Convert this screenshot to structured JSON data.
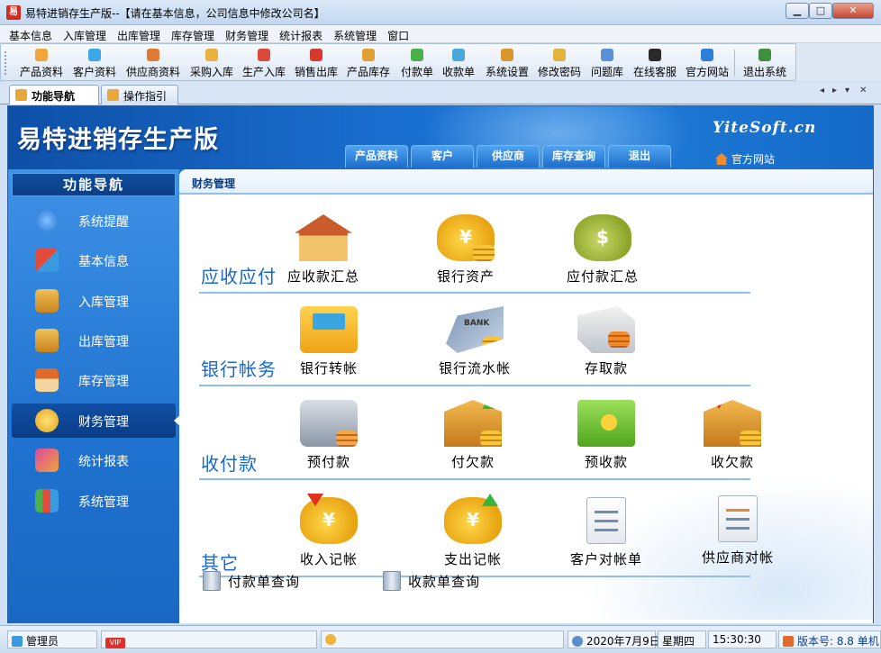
{
  "window": {
    "title": "易特进销存生产版--【请在基本信息，公司信息中修改公司名】",
    "app_icon_text": "易",
    "controls": {
      "minimize": "▁",
      "maximize": "□",
      "close": "✕"
    }
  },
  "menu": [
    "基本信息",
    "入库管理",
    "出库管理",
    "库存管理",
    "财务管理",
    "统计报表",
    "系统管理",
    "窗口"
  ],
  "toolbar": [
    {
      "label": "产品资料",
      "icon": "product-icon",
      "color": "#f0a63a"
    },
    {
      "label": "客户资料",
      "icon": "customer-icon",
      "color": "#3aa7e6"
    },
    {
      "label": "供应商资料",
      "icon": "supplier-icon",
      "color": "#e07a32"
    },
    {
      "label": "采购入库",
      "icon": "purchase-icon",
      "color": "#e9b23f"
    },
    {
      "label": "生产入库",
      "icon": "production-icon",
      "color": "#d94a3b"
    },
    {
      "label": "销售出库",
      "icon": "sales-icon",
      "color": "#d63a2f"
    },
    {
      "label": "产品库存",
      "icon": "inventory-icon",
      "color": "#e0a235"
    },
    {
      "label": "付款单",
      "icon": "payment-icon",
      "color": "#4bb04b"
    },
    {
      "label": "收款单",
      "icon": "receipt-icon",
      "color": "#49a8d8"
    },
    {
      "label": "系统设置",
      "icon": "settings-icon",
      "color": "#d8962e"
    },
    {
      "label": "修改密码",
      "icon": "password-icon",
      "color": "#e1b43d"
    },
    {
      "label": "问题库",
      "icon": "question-icon",
      "color": "#5b8fd6"
    },
    {
      "label": "在线客服",
      "icon": "qq-icon",
      "color": "#2a2a2a"
    },
    {
      "label": "官方网站",
      "icon": "ie-icon",
      "color": "#2e7fd8"
    },
    {
      "label": "退出系统",
      "icon": "exit-icon",
      "color": "#3f8f3f"
    }
  ],
  "tabs": [
    {
      "label": "功能导航",
      "active": true
    },
    {
      "label": "操作指引",
      "active": false
    }
  ],
  "tab_controls": [
    "◂",
    "▸",
    "▾",
    "✕"
  ],
  "banner": {
    "title": "易特进销存生产版",
    "site": "YiteSoft.cn",
    "tabs": [
      "产品资料",
      "客户",
      "供应商",
      "库存查询",
      "退出"
    ],
    "home_link": "官方网站"
  },
  "sidebar": {
    "header": "功能导航",
    "items": [
      {
        "label": "系统提醒",
        "icon": "info-icon",
        "color": "#3a8fe0"
      },
      {
        "label": "基本信息",
        "icon": "cubes-icon",
        "color": "#e24a3a"
      },
      {
        "label": "入库管理",
        "icon": "box-in-icon",
        "color": "#e0a235"
      },
      {
        "label": "出库管理",
        "icon": "box-out-icon",
        "color": "#e0a235"
      },
      {
        "label": "库存管理",
        "icon": "warehouse-icon",
        "color": "#e06a2a"
      },
      {
        "label": "财务管理",
        "icon": "finance-icon",
        "color": "#f2c33a",
        "active": true
      },
      {
        "label": "统计报表",
        "icon": "report-icon",
        "color": "#d94aa0"
      },
      {
        "label": "系统管理",
        "icon": "system-icon",
        "color": "#4bb04b"
      }
    ]
  },
  "content": {
    "breadcrumb": "财务管理",
    "sections": [
      {
        "title": "应收应付",
        "items": [
          "应收款汇总",
          "银行资产",
          "应付款汇总"
        ]
      },
      {
        "title": "银行帐务",
        "items": [
          "银行转帐",
          "银行流水帐",
          "存取款"
        ]
      },
      {
        "title": "收付款",
        "items": [
          "预付款",
          "付欠款",
          "预收款",
          "收欠款"
        ]
      },
      {
        "title": "其它",
        "items": [
          "收入记帐",
          "支出记帐",
          "客户对帐单",
          "供应商对帐"
        ]
      }
    ],
    "quick_links": [
      "付款单查询",
      "收款单查询"
    ],
    "icon_marks": {
      "yuan": "¥",
      "dollar": "$",
      "bank": "BANK"
    }
  },
  "status": {
    "user": "管理员",
    "vip": "VIP",
    "date": "2020年7月9日",
    "weekday": "星期四",
    "time": "15:30:30",
    "version": "版本号: 8.8 单机"
  }
}
